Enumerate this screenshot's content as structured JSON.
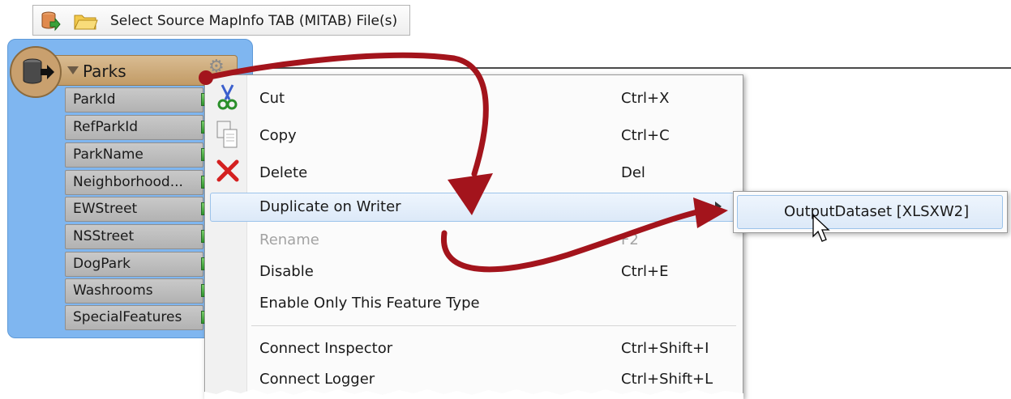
{
  "toolbar": {
    "label": "Select Source MapInfo TAB (MITAB) File(s)",
    "icons": [
      "database-add-icon",
      "open-folder-icon"
    ]
  },
  "feature_type": {
    "name": "Parks",
    "attributes": [
      "ParkId",
      "RefParkId",
      "ParkName",
      "Neighborhood...",
      "EWStreet",
      "NSStreet",
      "DogPark",
      "Washrooms",
      "SpecialFeatures"
    ]
  },
  "context_menu": {
    "cut": {
      "label": "Cut",
      "shortcut": "Ctrl+X"
    },
    "copy": {
      "label": "Copy",
      "shortcut": "Ctrl+C"
    },
    "delete": {
      "label": "Delete",
      "shortcut": "Del"
    },
    "duplicate": {
      "label": "Duplicate on Writer"
    },
    "rename": {
      "label": "Rename",
      "shortcut": "F2"
    },
    "disable": {
      "label": "Disable",
      "shortcut": "Ctrl+E"
    },
    "enable_only": {
      "label": "Enable Only This Feature Type"
    },
    "connect_inspector": {
      "label": "Connect Inspector",
      "shortcut": "Ctrl+Shift+I"
    },
    "connect_logger": {
      "label": "Connect Logger",
      "shortcut": "Ctrl+Shift+L"
    }
  },
  "submenu": {
    "item": "OutputDataset [XLSXW2]"
  },
  "colors": {
    "arrow": "#a3141c",
    "feature_type_bg": "#7fb6f0",
    "header_bg": "#c9a574",
    "highlight": "#dce9f8"
  }
}
